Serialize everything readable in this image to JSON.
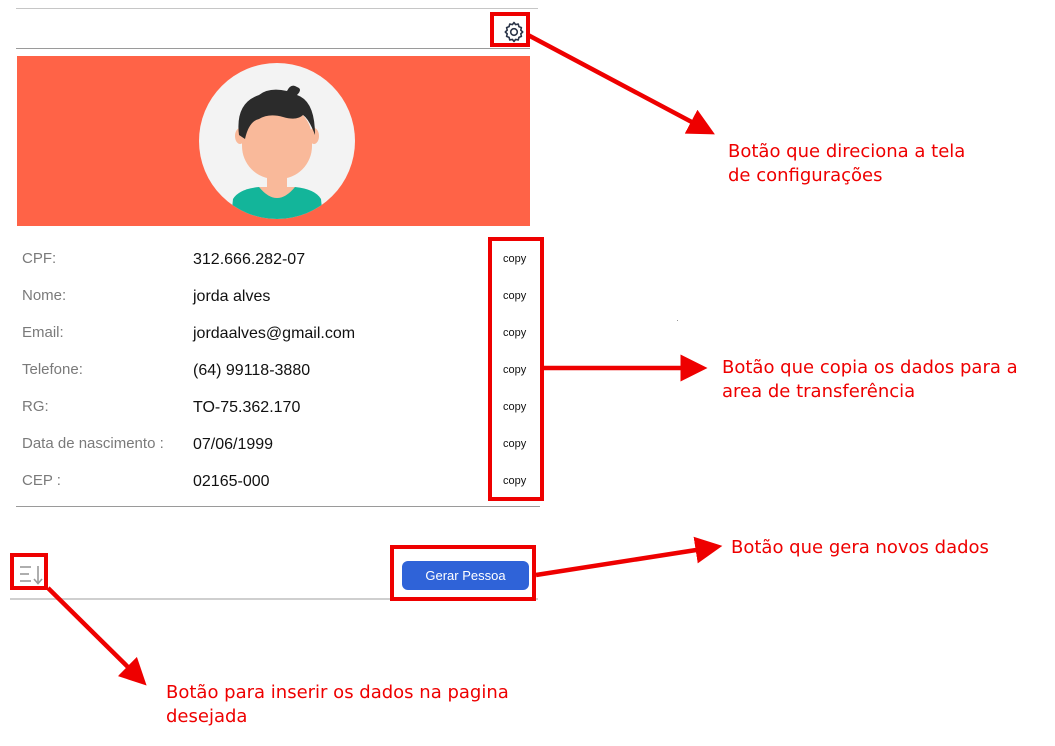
{
  "header": {
    "settings_icon": "gear-icon"
  },
  "profile": {
    "avatar_icon": "user-avatar-icon",
    "banner_color": "#ff6347"
  },
  "fields": [
    {
      "label": "CPF:",
      "value": "312.666.282-07",
      "copy_label": "copy"
    },
    {
      "label": "Nome:",
      "value": "jorda alves",
      "copy_label": "copy"
    },
    {
      "label": "Email:",
      "value": "jordaalves@gmail.com",
      "copy_label": "copy"
    },
    {
      "label": "Telefone:",
      "value": "(64) 99118-3880",
      "copy_label": "copy"
    },
    {
      "label": "RG:",
      "value": "TO-75.362.170",
      "copy_label": "copy"
    },
    {
      "label": "Data de nascimento :",
      "value": "07/06/1999",
      "copy_label": "copy"
    },
    {
      "label": "CEP :",
      "value": "02165-000",
      "copy_label": "copy"
    }
  ],
  "footer": {
    "insert_icon": "list-sort-icon",
    "generate_button_label": "Gerar Pessoa",
    "button_color": "#2f63d8"
  },
  "annotations": {
    "color": "#ee0000",
    "settings": [
      "Botão que direciona a tela",
      "de configurações"
    ],
    "copy": [
      "Botão que copia os dados para a",
      "area de transferência"
    ],
    "generate": [
      "Botão que gera novos dados"
    ],
    "insert": [
      "Botão para inserir os dados na pagina",
      "desejada"
    ]
  }
}
